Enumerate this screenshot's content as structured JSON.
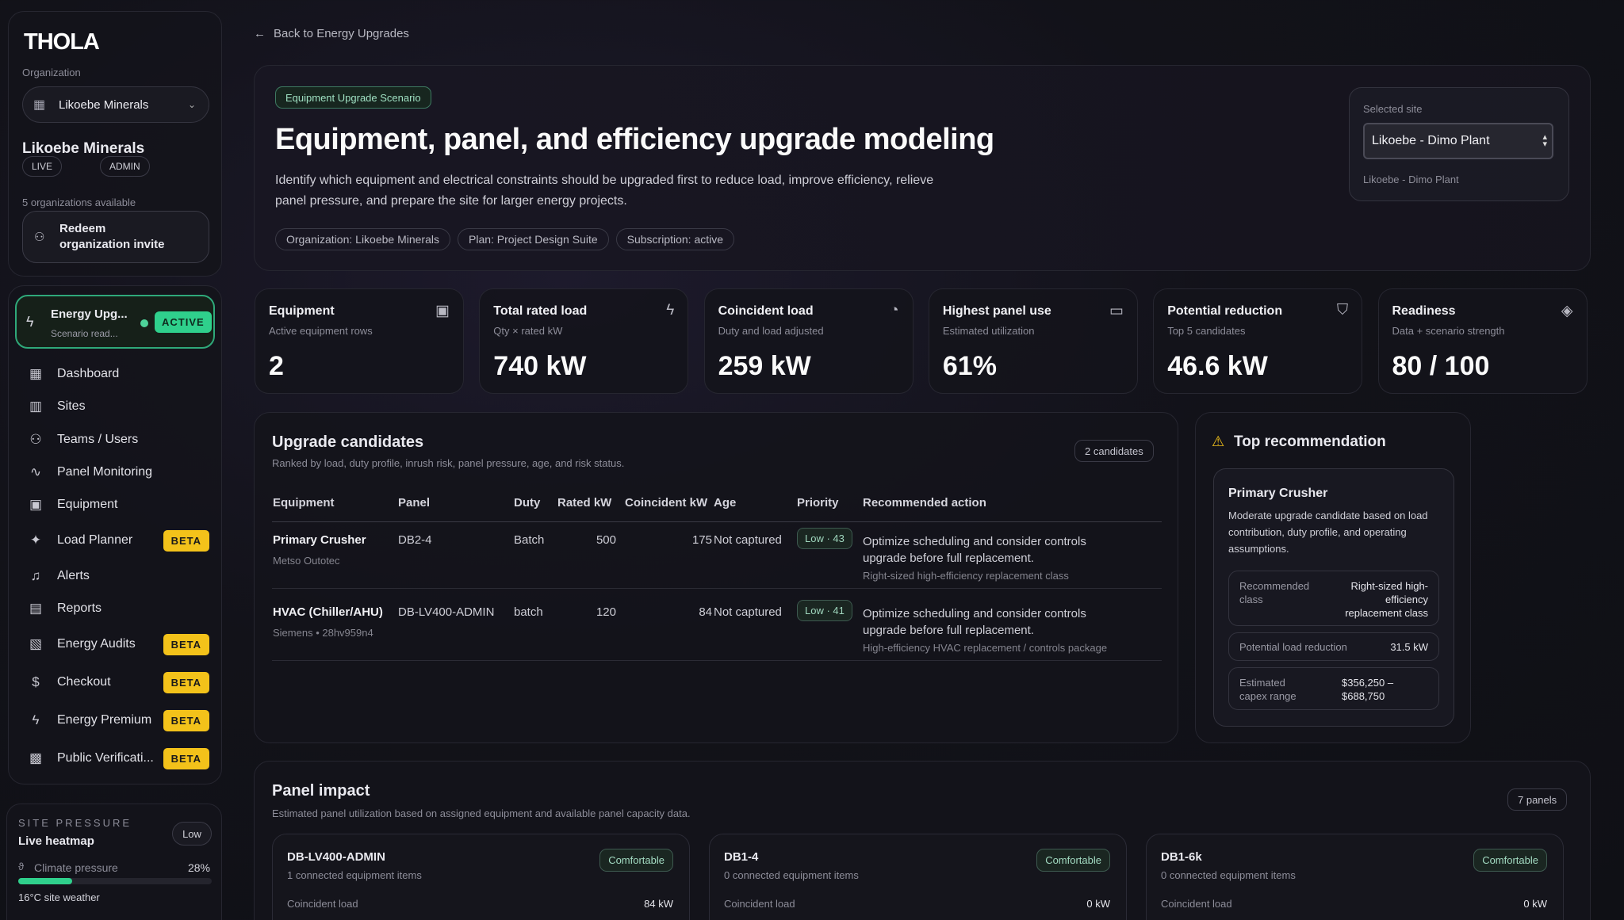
{
  "sidebar": {
    "logo": "THOLA",
    "org_label": "Organization",
    "org_select": "Likoebe Minerals",
    "org_name": "Likoebe Minerals",
    "badges": [
      "LIVE",
      "ADMIN"
    ],
    "org_count": "5 organizations available",
    "redeem_label": "Redeem organization invite",
    "active_item": {
      "title": "Energy Upg...",
      "sub": "Scenario read...",
      "badge": "ACTIVE"
    },
    "nav": [
      {
        "label": "Dashboard",
        "icon": "dashboard-icon",
        "beta": ""
      },
      {
        "label": "Sites",
        "icon": "chart-icon",
        "beta": ""
      },
      {
        "label": "Teams / Users",
        "icon": "users-icon",
        "beta": ""
      },
      {
        "label": "Panel Monitoring",
        "icon": "activity-icon",
        "beta": ""
      },
      {
        "label": "Equipment",
        "icon": "chip-icon",
        "beta": ""
      },
      {
        "label": "Load Planner",
        "icon": "sparkle-icon",
        "beta": "BETA"
      },
      {
        "label": "Alerts",
        "icon": "bell-icon",
        "beta": ""
      },
      {
        "label": "Reports",
        "icon": "document-icon",
        "beta": ""
      },
      {
        "label": "Energy Audits",
        "icon": "clipboard-icon",
        "beta": "BETA"
      },
      {
        "label": "Checkout",
        "icon": "dollar-icon",
        "beta": "BETA"
      },
      {
        "label": "Energy Premium",
        "icon": "bolt-icon",
        "beta": "BETA"
      },
      {
        "label": "Public Verificati...",
        "icon": "qr-icon",
        "beta": "BETA"
      }
    ],
    "pressure": {
      "eyebrow": "SITE PRESSURE",
      "title": "Live heatmap",
      "level": "Low",
      "climate_label": "Climate pressure",
      "climate_pct": "28%",
      "climate_fraction": 0.28,
      "weather": "16°C site weather"
    }
  },
  "back_link": "Back to Energy Upgrades",
  "hero": {
    "tag": "Equipment Upgrade Scenario",
    "title": "Equipment, panel, and efficiency upgrade modeling",
    "description": "Identify which equipment and electrical constraints should be upgraded first to reduce load, improve efficiency, relieve panel pressure, and prepare the site for larger energy projects.",
    "chips": [
      "Organization: Likoebe Minerals",
      "Plan: Project Design Suite",
      "Subscription: active"
    ],
    "site_label": "Selected site",
    "site_select": "Likoebe - Dimo Plant",
    "site_caption": "Likoebe - Dimo Plant"
  },
  "stats": [
    {
      "title": "Equipment",
      "sub": "Active equipment rows",
      "value": "2",
      "icon": "chip-icon"
    },
    {
      "title": "Total rated load",
      "sub": "Qty × rated kW",
      "value": "740 kW",
      "icon": "bolt-icon"
    },
    {
      "title": "Coincident load",
      "sub": "Duty and load adjusted",
      "value": "259 kW",
      "icon": "gauge-icon"
    },
    {
      "title": "Highest panel use",
      "sub": "Estimated utilization",
      "value": "61%",
      "icon": "panel-icon"
    },
    {
      "title": "Potential reduction",
      "sub": "Top 5 candidates",
      "value": "46.6 kW",
      "icon": "shield-icon"
    },
    {
      "title": "Readiness",
      "sub": "Data + scenario strength",
      "value": "80 / 100",
      "icon": "layers-icon"
    }
  ],
  "candidates": {
    "title": "Upgrade candidates",
    "sub": "Ranked by load, duty profile, inrush risk, panel pressure, age, and risk status.",
    "count": "2 candidates",
    "headers": [
      "Equipment",
      "Panel",
      "Duty",
      "Rated kW",
      "Coincident kW",
      "Age",
      "Priority",
      "Recommended action"
    ],
    "rows": [
      {
        "name": "Primary Crusher",
        "maker": "Metso Outotec",
        "panel": "DB2-4",
        "duty": "Batch",
        "rated": "500",
        "coincident": "175",
        "age": "Not captured",
        "priority": "Low · 43",
        "action": "Optimize scheduling and consider controls upgrade before full replacement.",
        "class": "Right-sized high-efficiency replacement class"
      },
      {
        "name": "HVAC (Chiller/AHU)",
        "maker": "Siemens • 28hv959n4",
        "panel": "DB-LV400-ADMIN",
        "duty": "batch",
        "rated": "120",
        "coincident": "84",
        "age": "Not captured",
        "priority": "Low · 41",
        "action": "Optimize scheduling and consider controls upgrade before full replacement.",
        "class": "High-efficiency HVAC replacement / controls package"
      }
    ]
  },
  "recommendation": {
    "title": "Top recommendation",
    "item": "Primary Crusher",
    "desc": "Moderate upgrade candidate based on load contribution, duty profile, and operating assumptions.",
    "class_label": "Recommended class",
    "class_value": "Right-sized high-efficiency replacement class",
    "reduction_label": "Potential load reduction",
    "reduction_value": "31.5 kW",
    "capex_label": "Estimated capex range",
    "capex_value": "$356,250 – $688,750"
  },
  "panel_impact": {
    "title": "Panel impact",
    "sub": "Estimated panel utilization based on assigned equipment and available panel capacity data.",
    "count": "7 panels",
    "panels": [
      {
        "name": "DB-LV400-ADMIN",
        "items": "1 connected equipment items",
        "status": "Comfortable",
        "load_label": "Coincident load",
        "load": "84 kW"
      },
      {
        "name": "DB1-4",
        "items": "0 connected equipment items",
        "status": "Comfortable",
        "load_label": "Coincident load",
        "load": "0 kW"
      },
      {
        "name": "DB1-6k",
        "items": "0 connected equipment items",
        "status": "Comfortable",
        "load_label": "Coincident load",
        "load": "0 kW"
      }
    ]
  }
}
